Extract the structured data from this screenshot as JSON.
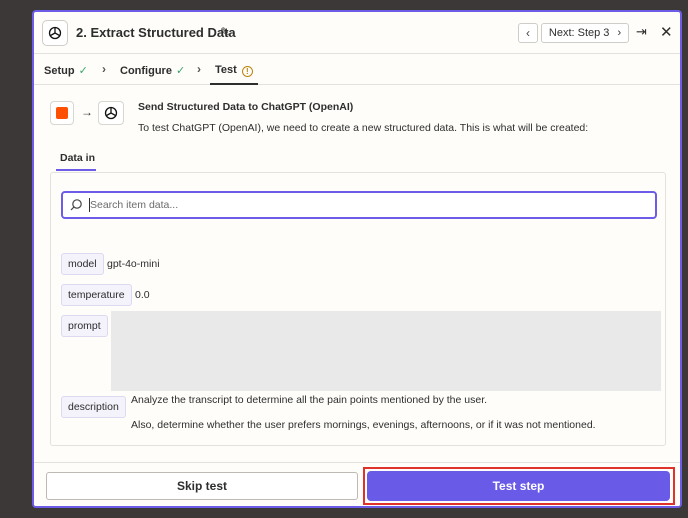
{
  "header": {
    "title": "2. Extract Structured Data",
    "next_label": "Next: Step 3",
    "prev_glyph": "‹",
    "next_glyph": "›",
    "collapse_glyph": "⇥",
    "close_glyph": "✕",
    "edit_glyph": "✎",
    "icons": {
      "app": "openai-logo-icon",
      "edit": "pencil-icon",
      "prev": "chevron-left-icon",
      "next": "chevron-right-icon",
      "collapse": "collapse-panel-icon",
      "close": "close-icon"
    }
  },
  "steps": {
    "items": [
      {
        "label": "Setup",
        "status": "done",
        "mark": "✓"
      },
      {
        "label": "Configure",
        "status": "done",
        "mark": "✓"
      },
      {
        "label": "Test",
        "status": "warning",
        "mark": "!"
      }
    ],
    "separator": "›",
    "active": "Test"
  },
  "summary": {
    "title": "Send Structured Data to ChatGPT (OpenAI)",
    "description": "To test ChatGPT (OpenAI), we need to create a new structured data. This is what will be created:",
    "arrow": "→"
  },
  "tabs": [
    {
      "label": "Data in",
      "active": true
    }
  ],
  "search": {
    "placeholder": "Search item data..."
  },
  "fields": [
    {
      "key": "model",
      "value": "gpt-4o-mini"
    },
    {
      "key": "temperature",
      "value": "0.0"
    },
    {
      "key": "prompt",
      "value": ""
    },
    {
      "key": "description",
      "lines": [
        "Analyze the transcript to determine all the pain points mentioned by the user.",
        "Also, determine whether the user prefers mornings, evenings, afternoons, or if it was not mentioned."
      ]
    }
  ],
  "footer": {
    "skip_label": "Skip test",
    "test_label": "Test step"
  },
  "colors": {
    "accent": "#6c5ce7",
    "primary_button": "#695be8",
    "trigger_orange": "#ff4f00",
    "success": "#3aa46a",
    "warning": "#b8860b",
    "highlight_outline": "#e0322b"
  }
}
